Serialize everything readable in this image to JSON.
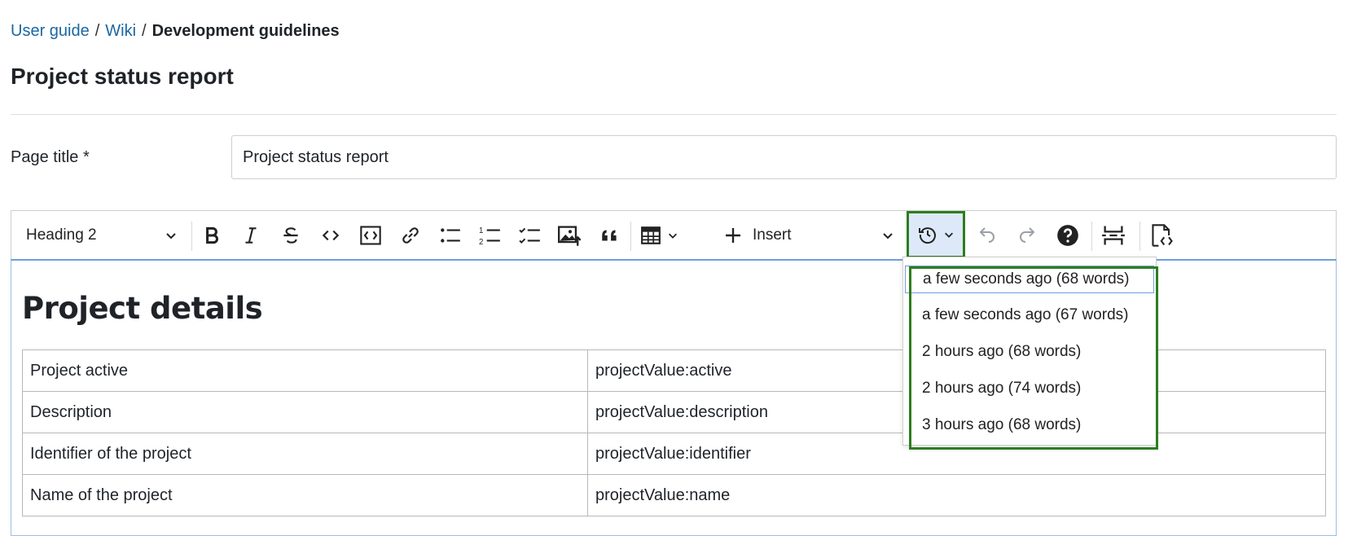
{
  "breadcrumb": {
    "items": [
      "User guide",
      "Wiki"
    ],
    "separator": "/",
    "current": "Development guidelines"
  },
  "page": {
    "title": "Project status report"
  },
  "form": {
    "page_title_label": "Page title *",
    "page_title_value": "Project status report"
  },
  "toolbar": {
    "heading_value": "Heading 2",
    "insert_label": "Insert",
    "icons": [
      "bold-icon",
      "italic-icon",
      "strikethrough-icon",
      "code-icon",
      "code-block-icon",
      "link-icon",
      "bulleted-list-icon",
      "numbered-list-icon",
      "todo-list-icon",
      "insert-image-icon",
      "block-quote-icon",
      "table-icon",
      "plus-icon",
      "history-icon",
      "undo-icon",
      "redo-icon",
      "help-icon",
      "page-break-icon",
      "source-icon"
    ]
  },
  "editor": {
    "heading": "Project details",
    "rows": [
      [
        "Project active",
        "projectValue:active"
      ],
      [
        "Description",
        "projectValue:description"
      ],
      [
        "Identifier of the project",
        "projectValue:identifier"
      ],
      [
        "Name of the project",
        "projectValue:name"
      ]
    ]
  },
  "revisions": {
    "items": [
      "a few seconds ago (68 words)",
      "a few seconds ago (67 words)",
      "2 hours ago (68 words)",
      "2 hours ago (74 words)",
      "3 hours ago (68 words)"
    ]
  },
  "colors": {
    "link": "#1a67a3",
    "highlight": "#2e7d1e",
    "focus": "#6f9fdc",
    "active_bg": "#dde9f9"
  }
}
